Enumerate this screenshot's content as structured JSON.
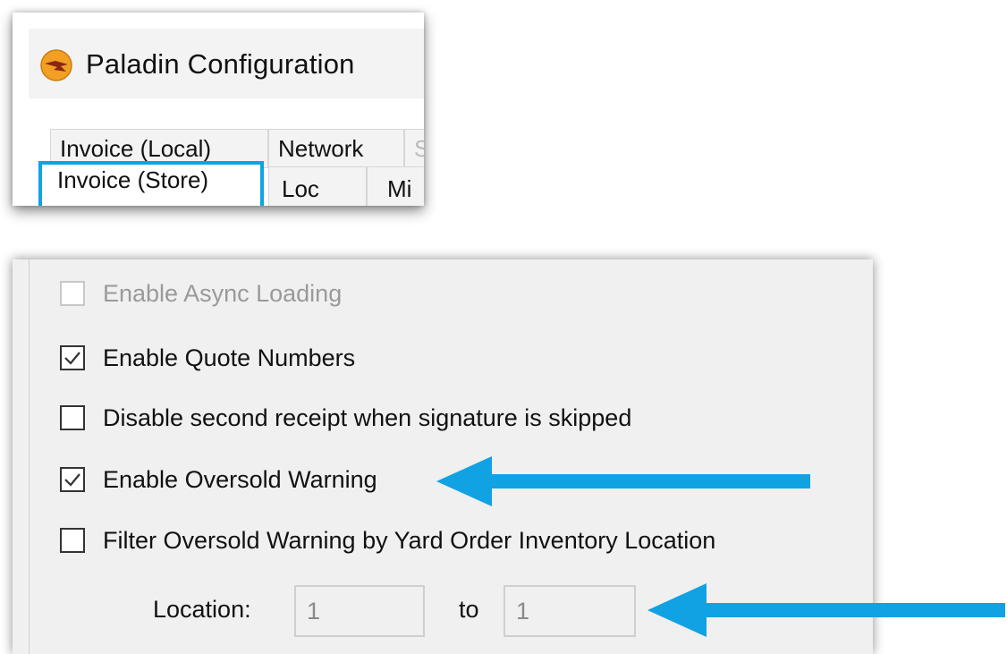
{
  "window": {
    "title": "Paladin Configuration",
    "icon": "paladin-app-icon"
  },
  "tabs": {
    "row1": [
      "Invoice (Local)",
      "Network",
      "S"
    ],
    "row2": [
      "Invoice (Store)",
      "Loc",
      "Mi"
    ],
    "selected": "Invoice (Store)"
  },
  "options": [
    {
      "label": "Enable Async Loading",
      "checked": false,
      "enabled": false
    },
    {
      "label": "Enable Quote Numbers",
      "checked": true,
      "enabled": true
    },
    {
      "label": "Disable second receipt when signature is skipped",
      "checked": false,
      "enabled": true
    },
    {
      "label": "Enable Oversold Warning",
      "checked": true,
      "enabled": true
    },
    {
      "label": "Filter Oversold Warning by Yard Order Inventory Location",
      "checked": false,
      "enabled": true
    }
  ],
  "location": {
    "label": "Location:",
    "from_value": "1",
    "to_label": "to",
    "to_value": "1"
  },
  "colors": {
    "accent": "#10a2e2",
    "highlight_border": "#10a2e2",
    "arrow": "#10a2e2"
  }
}
